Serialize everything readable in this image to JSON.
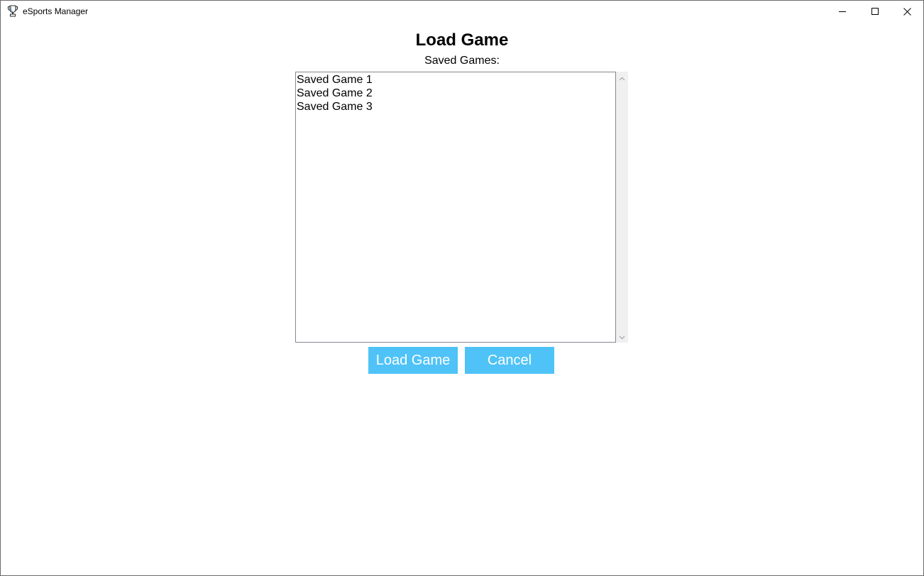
{
  "window": {
    "title": "eSports Manager",
    "icon": "trophy-icon",
    "controls": {
      "minimize_icon": "minimize-icon",
      "maximize_icon": "maximize-icon",
      "close_icon": "close-icon"
    }
  },
  "main": {
    "title": "Load Game",
    "list_label": "Saved Games:",
    "saved_games": [
      "Saved Game 1",
      "Saved Game 2",
      "Saved Game 3"
    ],
    "scrollbar": {
      "up_icon": "scroll-up-icon",
      "down_icon": "scroll-down-icon"
    }
  },
  "actions": {
    "load_label": "Load Game",
    "cancel_label": "Cancel"
  },
  "colors": {
    "button_background": "#4fc3f7",
    "button_text": "#ffffff",
    "scrollbar_track": "#f0f0f0",
    "listbox_border": "#828790"
  }
}
